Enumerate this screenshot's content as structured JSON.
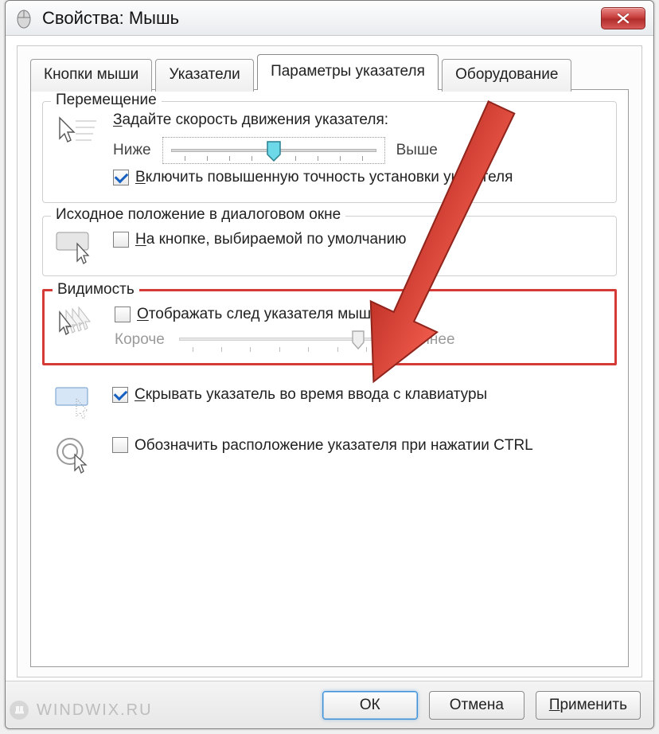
{
  "title": "Свойства: Мышь",
  "tabs": {
    "buttons": "Кнопки мыши",
    "pointers": "Указатели",
    "pointer_options": "Параметры указателя",
    "hardware": "Оборудование"
  },
  "motion": {
    "legend": "Перемещение",
    "speed_label_pre": "З",
    "speed_label_rest": "адайте скорость движения указателя:",
    "slower": "Ниже",
    "faster": "Выше",
    "enhance_pre": "В",
    "enhance_rest": "ключить повышенную точность установки указателя"
  },
  "snap": {
    "legend": "Исходное положение в диалоговом окне",
    "label_pre": "Н",
    "label_rest": "а кнопке, выбираемой по умолчанию"
  },
  "visibility": {
    "legend": "Видимость",
    "trails_pre": "О",
    "trails_rest": "тображать след указателя мыши",
    "shorter": "Короче",
    "longer": "Длиннее",
    "hide_pre": "С",
    "hide_rest": "крывать указатель во время ввода с клавиатуры",
    "ctrl_label": "Обозначить расположение указателя при нажатии CTRL"
  },
  "buttons": {
    "ok": "ОК",
    "cancel": "Отмена",
    "apply": "Применить"
  },
  "watermark": "WINDWIX.RU",
  "chart_data": null
}
